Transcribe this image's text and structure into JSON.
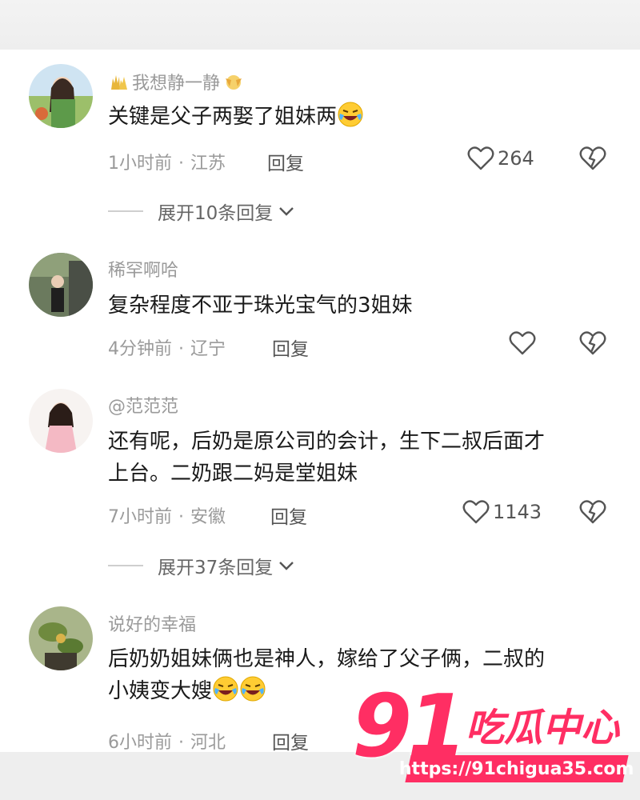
{
  "comments": [
    {
      "username": "我想静一静",
      "content": "关键是父子两娶了姐妹两",
      "time": "1小时前",
      "location": "江苏",
      "reply_label": "回复",
      "likes": "264",
      "expand_label": "展开10条回复"
    },
    {
      "username": "稀罕啊哈",
      "content": "复杂程度不亚于珠光宝气的3姐妹",
      "time": "4分钟前",
      "location": "辽宁",
      "reply_label": "回复",
      "likes": ""
    },
    {
      "username": "@范范范",
      "content_line1": "还有呢，后奶是原公司的会计，生下二叔后面才",
      "content_line2": "上台。二奶跟二妈是堂姐妹",
      "time": "7小时前",
      "location": "安徽",
      "reply_label": "回复",
      "likes": "1143",
      "expand_label": "展开37条回复"
    },
    {
      "username": "说好的幸福",
      "content_line1": "后奶奶姐妹俩也是神人，嫁给了父子俩，二叔的",
      "content_line2": "小姨变大嫂",
      "time": "6小时前",
      "location": "河北",
      "reply_label": "回复"
    }
  ],
  "separator": "·",
  "watermark": {
    "number": "91",
    "name": "吃瓜中心",
    "url": "https://91chigua35.com"
  },
  "colors": {
    "watermark": "#ff2e63",
    "meta_text": "#9a9a9a",
    "body_text": "#1a1a1a"
  },
  "icons": [
    "heart-outline-icon",
    "broken-heart-icon",
    "chevron-down-icon",
    "laughing-crying-emoji"
  ]
}
